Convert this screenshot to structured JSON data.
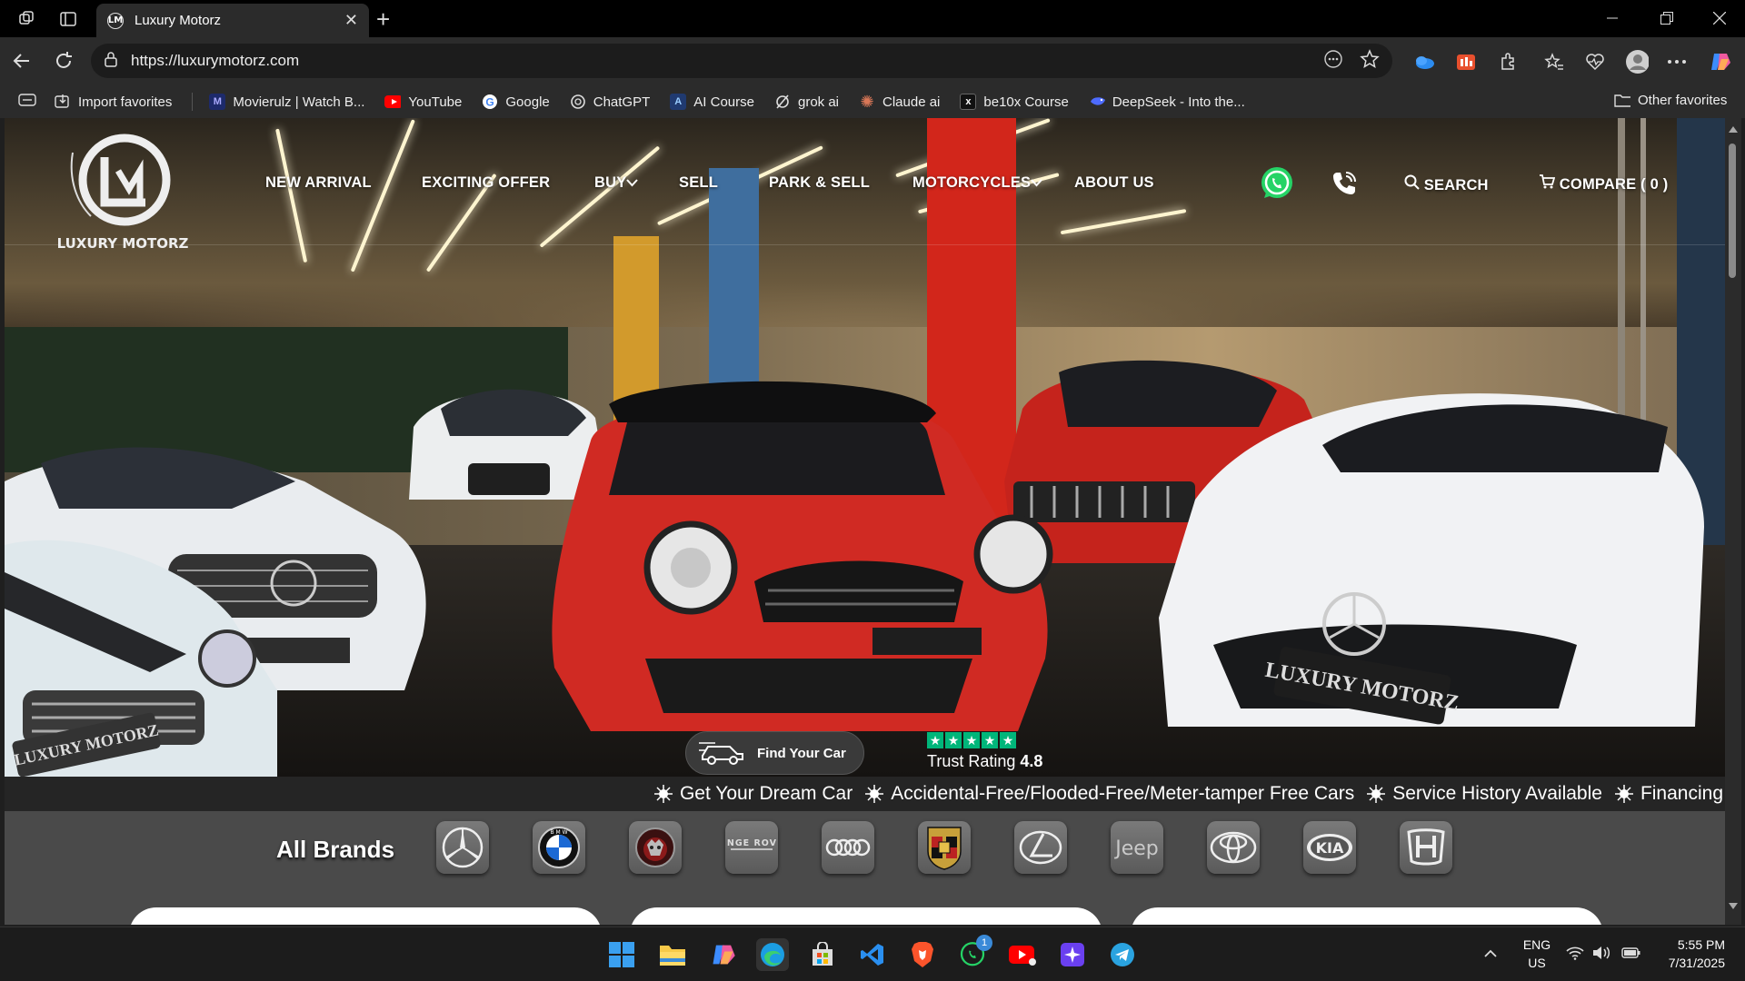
{
  "browser": {
    "tab_title": "Luxury Motorz",
    "url": "https://luxurymotorz.com",
    "favorites": [
      {
        "label": "Import favorites",
        "icon": "import-icon"
      },
      {
        "label": "Movierulz | Watch B...",
        "icon": "movierulz-icon"
      },
      {
        "label": "YouTube",
        "icon": "youtube-icon"
      },
      {
        "label": "Google",
        "icon": "google-icon"
      },
      {
        "label": "ChatGPT",
        "icon": "chatgpt-icon"
      },
      {
        "label": "AI Course",
        "icon": "ai-course-icon"
      },
      {
        "label": "grok ai",
        "icon": "grok-icon"
      },
      {
        "label": "Claude ai",
        "icon": "claude-icon"
      },
      {
        "label": "be10x Course",
        "icon": "be10x-icon"
      },
      {
        "label": "DeepSeek - Into the...",
        "icon": "deepseek-icon"
      }
    ],
    "other_favorites": "Other favorites"
  },
  "site": {
    "logo_text": "LUXURY MOTORZ",
    "nav": {
      "new_arrival": "NEW ARRIVAL",
      "exciting_offer": "EXCITING OFFER",
      "buy": "BUY",
      "sell": "SELL",
      "park_sell": "PARK & SELL",
      "motorcycles": "MOTORCYCLES",
      "about_us": "ABOUT US",
      "search": "SEARCH",
      "compare": "COMPARE ( 0 )"
    },
    "find_car": "Find Your Car",
    "trust_label": "Trust Rating",
    "trust_value": "4.8",
    "trust_stars": 5,
    "ticker": [
      "Get Your Dream Car",
      "Accidental-Free/Flooded-Free/Meter-tamper Free Cars",
      "Service History Available",
      "Financing"
    ],
    "brands_label": "All Brands",
    "brands": [
      "Mercedes-Benz",
      "BMW",
      "Jaguar",
      "Range Rover",
      "Audi",
      "Porsche",
      "Lexus",
      "Jeep",
      "Toyota",
      "KIA",
      "Honda"
    ],
    "brand_text": {
      "range_rover": "RANGE ROVER",
      "jeep": "Jeep",
      "kia": "KIA"
    }
  },
  "colors": {
    "accent_red": "#e1251b",
    "trust_green": "#00b67a",
    "whatsapp": "#25d366"
  },
  "taskbar": {
    "lang": "ENG",
    "region": "US",
    "time": "5:55 PM",
    "date": "7/31/2025",
    "whatsapp_badge": "1"
  }
}
